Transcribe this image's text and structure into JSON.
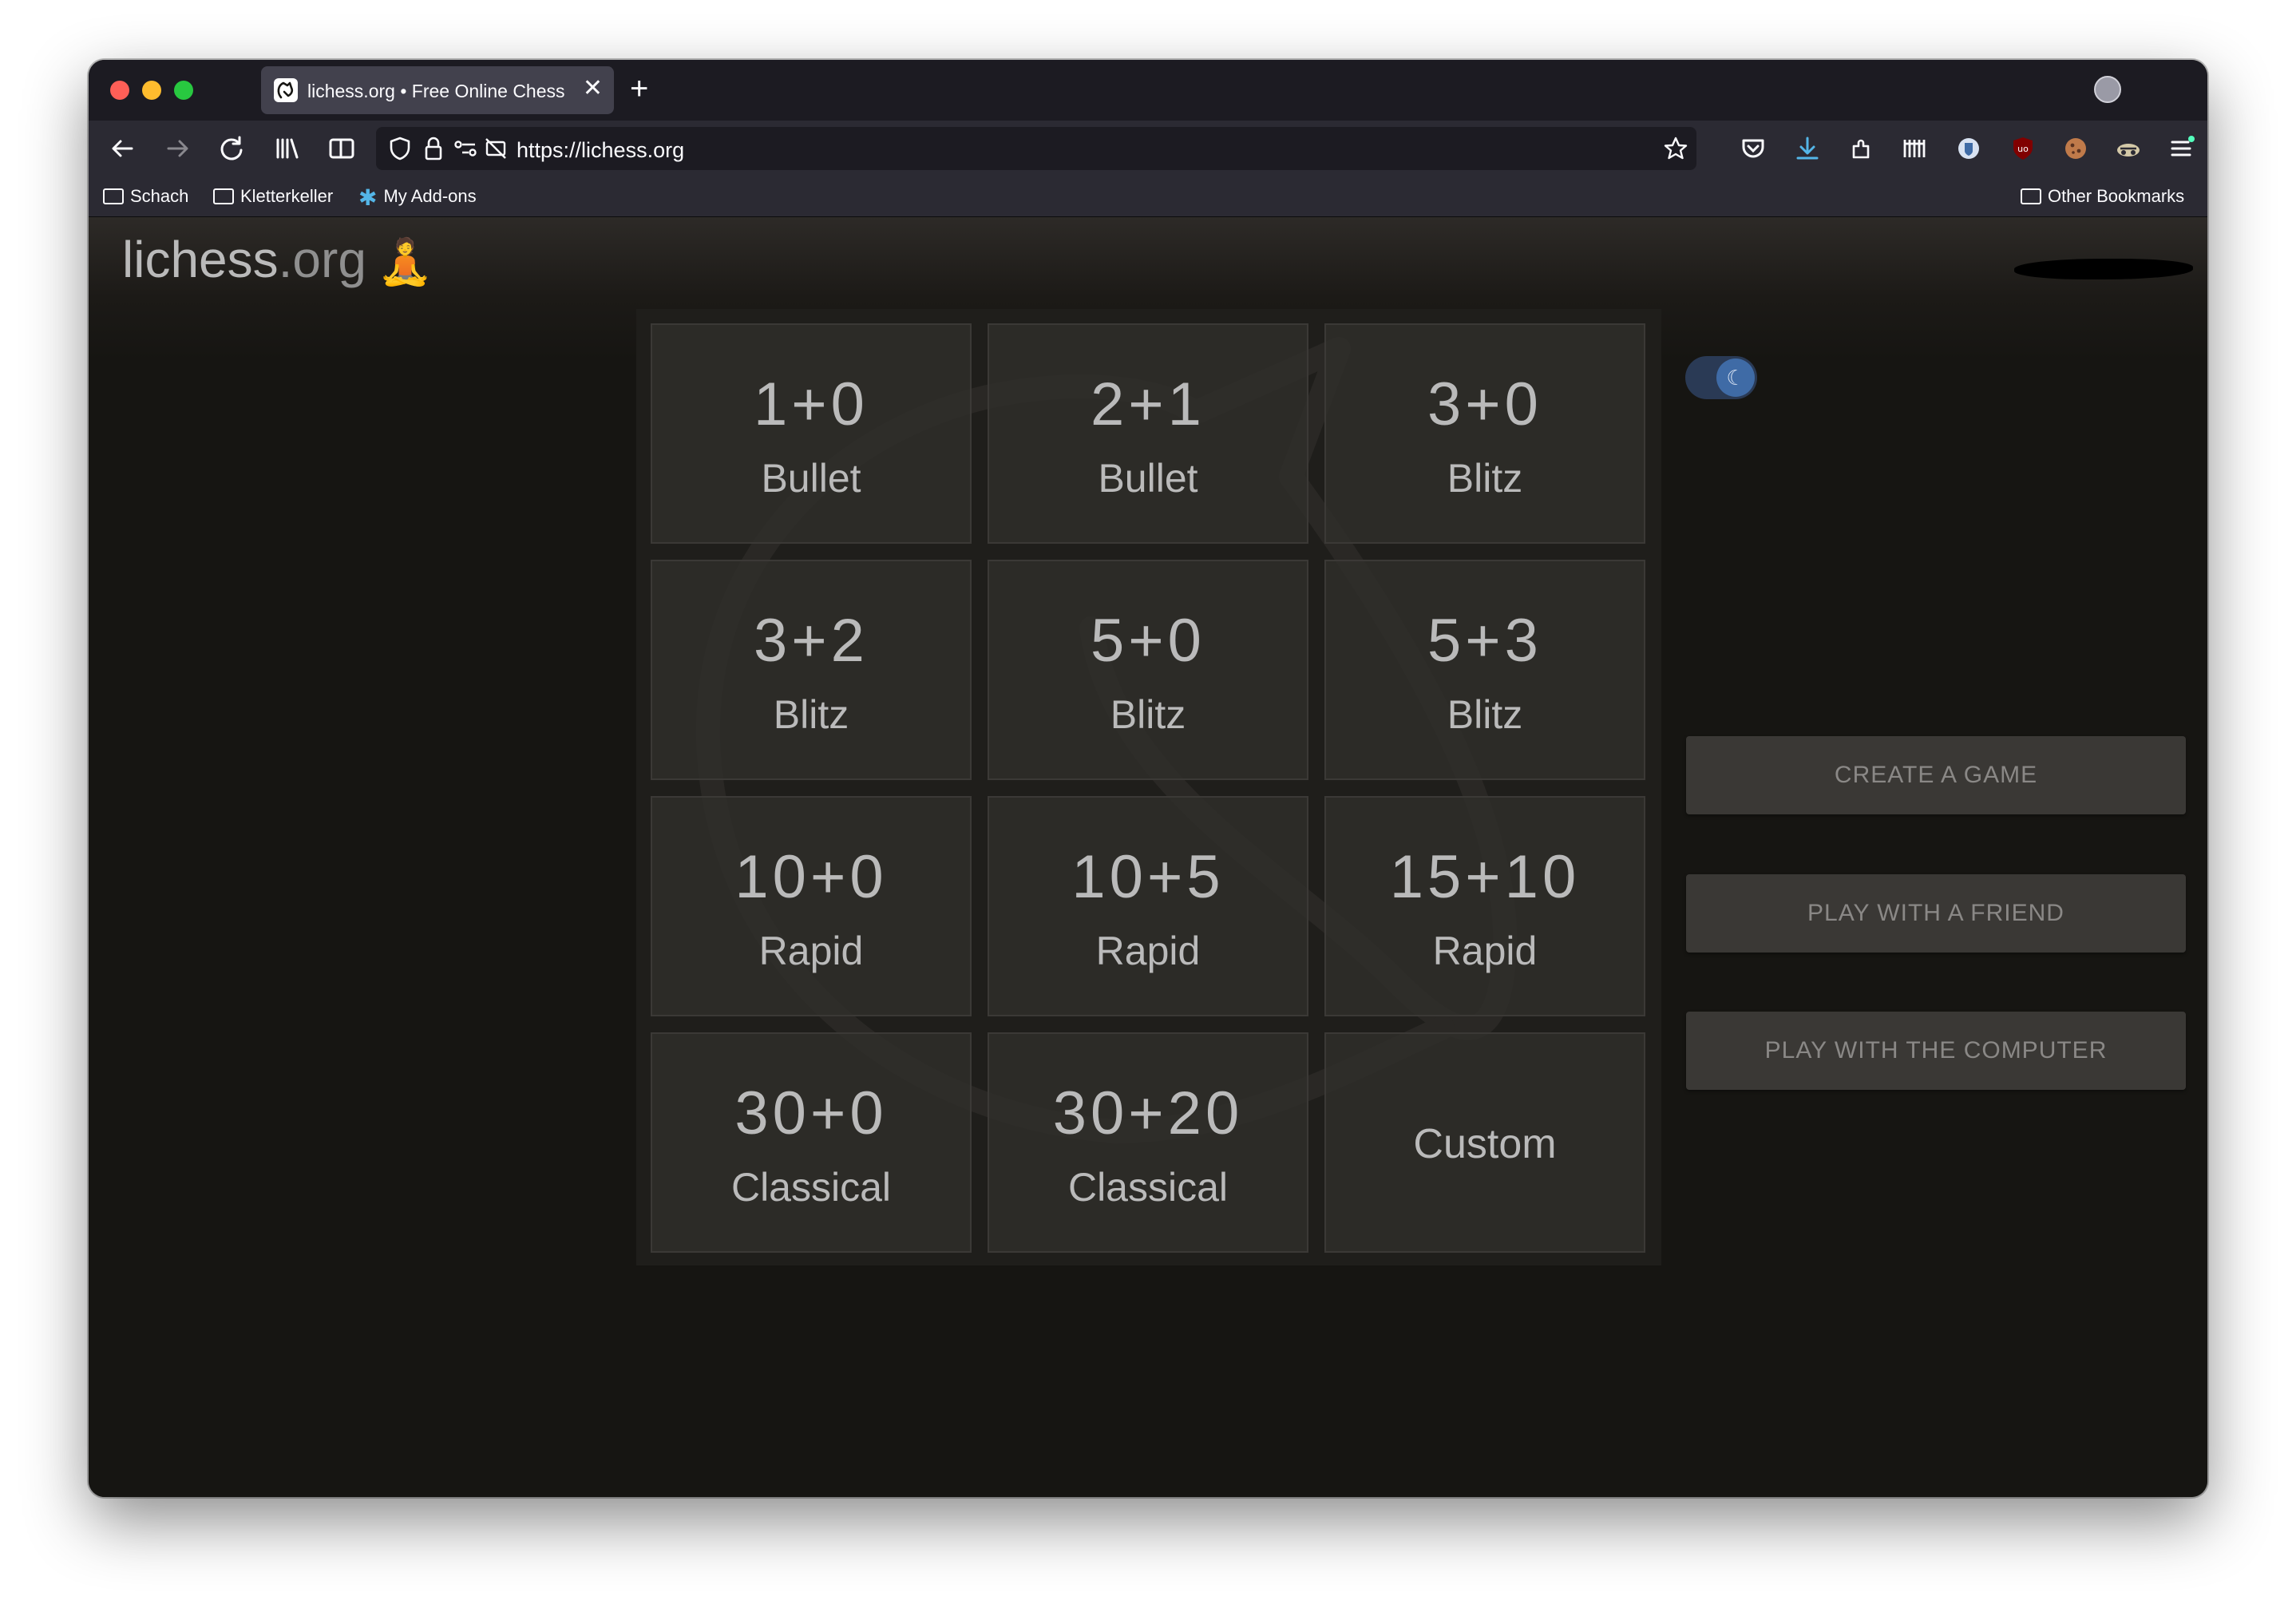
{
  "browser": {
    "tab": {
      "title": "lichess.org • Free Online Chess",
      "close_glyph": "✕"
    },
    "new_tab_glyph": "+",
    "url": "https://lichess.org",
    "bookmarks": [
      {
        "label": "Schach",
        "icon": "folder-icon"
      },
      {
        "label": "Kletterkeller",
        "icon": "folder-icon"
      },
      {
        "label": "My Add-ons",
        "icon": "puzzle-icon"
      }
    ],
    "other_bookmarks": "Other Bookmarks"
  },
  "header": {
    "logo_main": "lichess",
    "logo_tld": ".org",
    "zen_icon": "meditation-icon"
  },
  "quick_pairing": [
    {
      "clock": "1+0",
      "perf": "Bullet"
    },
    {
      "clock": "2+1",
      "perf": "Bullet"
    },
    {
      "clock": "3+0",
      "perf": "Blitz"
    },
    {
      "clock": "3+2",
      "perf": "Blitz"
    },
    {
      "clock": "5+0",
      "perf": "Blitz"
    },
    {
      "clock": "5+3",
      "perf": "Blitz"
    },
    {
      "clock": "10+0",
      "perf": "Rapid"
    },
    {
      "clock": "10+5",
      "perf": "Rapid"
    },
    {
      "clock": "15+10",
      "perf": "Rapid"
    },
    {
      "clock": "30+0",
      "perf": "Classical"
    },
    {
      "clock": "30+20",
      "perf": "Classical"
    },
    {
      "custom": "Custom"
    }
  ],
  "actions": {
    "create_game": "CREATE A GAME",
    "play_friend": "PLAY WITH A FRIEND",
    "play_computer": "PLAY WITH THE COMPUTER"
  },
  "theme_toggle": {
    "state": "dark",
    "icon": "moon-icon"
  },
  "colors": {
    "page_background": "#161512",
    "text": "#bababa",
    "toggle": "#3f6ba6"
  }
}
